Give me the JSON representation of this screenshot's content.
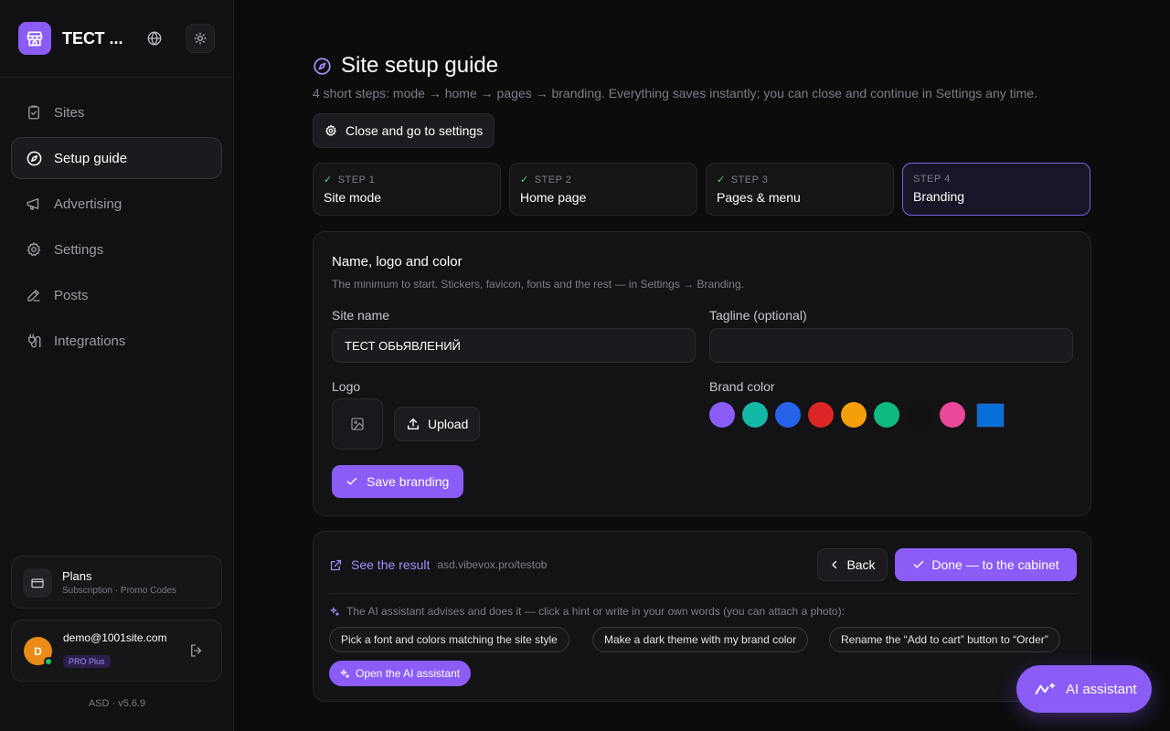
{
  "colors": {
    "accent": "#8b5cf6",
    "check": "#4ade80",
    "online": "#22c55e",
    "avatar": "#e98b16"
  },
  "sidebar": {
    "site_name": "ТЕСТ ...",
    "nav": [
      {
        "label": "Sites",
        "icon": "clipboard-icon"
      },
      {
        "label": "Setup guide",
        "icon": "compass-icon",
        "active": true
      },
      {
        "label": "Advertising",
        "icon": "megaphone-icon"
      },
      {
        "label": "Settings",
        "icon": "gear-icon"
      },
      {
        "label": "Posts",
        "icon": "pencil-icon"
      },
      {
        "label": "Integrations",
        "icon": "plug-icon"
      }
    ],
    "plans": {
      "title": "Plans",
      "subtitle": "Subscription · Promo Codes"
    },
    "user": {
      "initial": "D",
      "email": "demo@1001site.com",
      "plan_badge": "PRO Plus"
    },
    "version": "ASD · v5.6.9"
  },
  "main": {
    "title": "Site setup guide",
    "subtitle": "4 short steps: mode → home → pages → branding. Everything saves instantly; you can close and continue in Settings any time.",
    "close_button": "Close and go to settings",
    "steps": [
      {
        "label": "STEP 1",
        "name": "Site mode",
        "done": true
      },
      {
        "label": "STEP 2",
        "name": "Home page",
        "done": true
      },
      {
        "label": "STEP 3",
        "name": "Pages & menu",
        "done": true
      },
      {
        "label": "STEP 4",
        "name": "Branding",
        "done": false,
        "active": true
      }
    ],
    "branding": {
      "heading": "Name, logo and color",
      "description": "The minimum to start. Stickers, favicon, fonts and the rest — in Settings → Branding.",
      "site_name_label": "Site name",
      "site_name_value": "ТЕСТ ОБЬЯВЛЕНИЙ",
      "tagline_label": "Tagline (optional)",
      "tagline_value": "",
      "logo_label": "Logo",
      "upload_button": "Upload",
      "brand_color_label": "Brand color",
      "brand_colors": [
        "#8b5cf6",
        "#14b8a6",
        "#2563eb",
        "#dc2626",
        "#f59e0b",
        "#10b981",
        "#111113",
        "#ec4899"
      ],
      "custom_color": "#0a6ed8",
      "save_button": "Save branding"
    },
    "footer": {
      "result_label": "See the result",
      "result_url": "asd.vibevox.pro/testob",
      "back_button": "Back",
      "done_button": "Done — to the cabinet",
      "ai_hint": "The AI assistant advises and does it — click a hint or write in your own words (you can attach a photo):",
      "chips": [
        "Pick a font and colors matching the site style",
        "Make a dark theme with my brand color",
        "Rename the “Add to cart” button to “Order”"
      ],
      "open_ai_button": "Open the AI assistant"
    }
  },
  "ai_fab": {
    "label": "AI assistant"
  }
}
